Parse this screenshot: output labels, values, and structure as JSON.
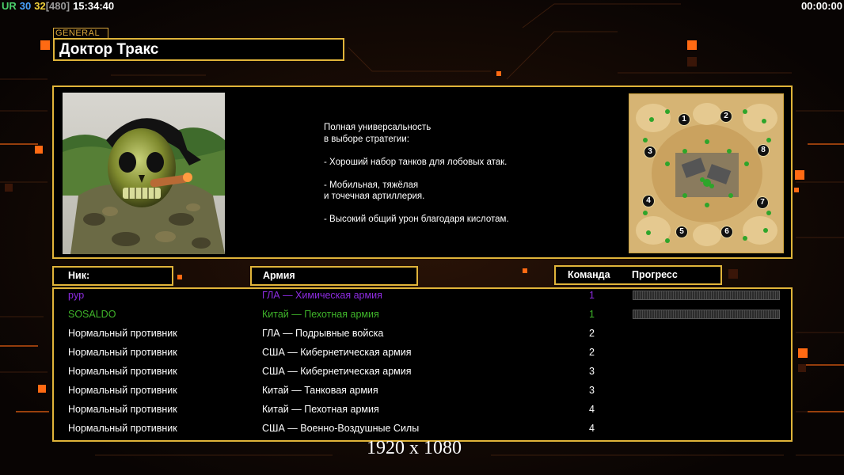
{
  "hud": {
    "ur_label": "UR",
    "fps_1": "30",
    "fps_2": "32",
    "latency": "[480]",
    "clock": "15:34:40",
    "timer": "00:00:00"
  },
  "general": {
    "tag": "GENERAL",
    "name": "Доктор Тракс"
  },
  "description": [
    "Полная универсальность",
    "в выборе стратегии:",
    "",
    "- Хороший набор танков для лобовых атак.",
    "",
    "- Мобильная, тяжёлая",
    "и точечная артиллерия.",
    "",
    "- Высокий общий урон благодаря кислотам."
  ],
  "map": {
    "start_positions": [
      "1",
      "2",
      "3",
      "8",
      "4",
      "7",
      "5",
      "6"
    ]
  },
  "headers": {
    "nick": "Ник:",
    "army": "Армия",
    "team": "Команда",
    "progress": "Прогресс"
  },
  "players": [
    {
      "nick": "pyp",
      "army": "ГЛА — Химическая армия",
      "team": "1",
      "color": "#8d2be0",
      "progress": 0
    },
    {
      "nick": "SOSALDO",
      "army": "Китай — Пехотная армия",
      "team": "1",
      "color": "#3fb52a",
      "progress": 0
    },
    {
      "nick": "Нормальный противник",
      "army": "ГЛА — Подрывные войска",
      "team": "2",
      "color": "#ffffff"
    },
    {
      "nick": "Нормальный противник",
      "army": "США — Кибернетическая армия",
      "team": "2",
      "color": "#ffffff"
    },
    {
      "nick": "Нормальный противник",
      "army": "США — Кибернетическая армия",
      "team": "3",
      "color": "#ffffff"
    },
    {
      "nick": "Нормальный противник",
      "army": "Китай — Танковая армия",
      "team": "3",
      "color": "#ffffff"
    },
    {
      "nick": "Нормальный противник",
      "army": "Китай — Пехотная армия",
      "team": "4",
      "color": "#ffffff"
    },
    {
      "nick": "Нормальный противник",
      "army": "США — Военно-Воздушные Силы",
      "team": "4",
      "color": "#ffffff"
    }
  ],
  "resolution": "1920 x 1080",
  "colors": {
    "accent": "#e0b43a",
    "hud_green": "#4cd26b",
    "hud_blue": "#4aa3ff",
    "hud_yellow": "#f2d23c",
    "hud_gray": "#9a9a9a",
    "orange_square": "#ff6a13"
  }
}
